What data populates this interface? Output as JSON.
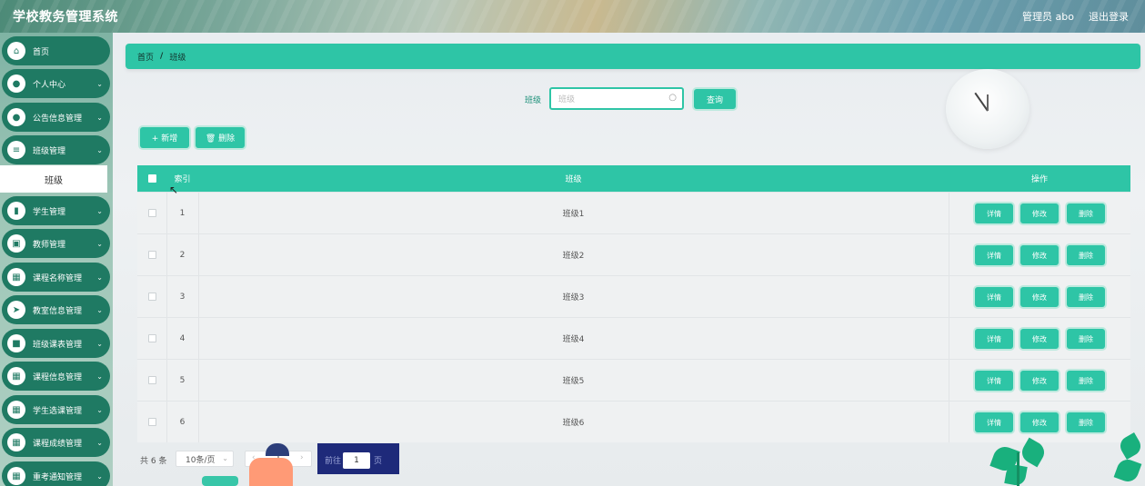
{
  "app": {
    "title": "学校教务管理系统"
  },
  "header": {
    "user": "管理员 abo",
    "logout": "退出登录"
  },
  "sidebar": {
    "items": [
      {
        "label": "首页",
        "icon": "home-icon",
        "glyph": "⌂",
        "chevron": false
      },
      {
        "label": "个人中心",
        "icon": "user-icon",
        "glyph": "●",
        "chevron": true
      },
      {
        "label": "公告信息管理",
        "icon": "user-icon",
        "glyph": "●",
        "chevron": true
      },
      {
        "label": "班级管理",
        "icon": "list-icon",
        "glyph": "≡",
        "chevron": true
      },
      {
        "label": "学生管理",
        "icon": "book-icon",
        "glyph": "▮",
        "chevron": true
      },
      {
        "label": "教师管理",
        "icon": "briefcase-icon",
        "glyph": "▣",
        "chevron": true
      },
      {
        "label": "课程名称管理",
        "icon": "grid-icon",
        "glyph": "▦",
        "chevron": true
      },
      {
        "label": "教室信息管理",
        "icon": "send-icon",
        "glyph": "➤",
        "chevron": true
      },
      {
        "label": "班级课表管理",
        "icon": "video-icon",
        "glyph": "■",
        "chevron": true
      },
      {
        "label": "课程信息管理",
        "icon": "grid-icon",
        "glyph": "▦",
        "chevron": true
      },
      {
        "label": "学生选课管理",
        "icon": "grid-icon",
        "glyph": "▦",
        "chevron": true
      },
      {
        "label": "课程成绩管理",
        "icon": "grid-icon",
        "glyph": "▦",
        "chevron": true
      },
      {
        "label": "重考通知管理",
        "icon": "grid-icon",
        "glyph": "▦",
        "chevron": true
      }
    ],
    "sub_item": "班级"
  },
  "breadcrumb": {
    "home": "首页",
    "separator": "/",
    "current": "班级"
  },
  "search": {
    "label": "班级",
    "placeholder": "班级",
    "button": "查询"
  },
  "actions": {
    "add": "+ 新增",
    "delete": "🗑 删除"
  },
  "table": {
    "headers": {
      "index": "索引",
      "class": "班级",
      "ops": "操作"
    },
    "rows": [
      {
        "index": "1",
        "class": "班级1"
      },
      {
        "index": "2",
        "class": "班级2"
      },
      {
        "index": "3",
        "class": "班级3"
      },
      {
        "index": "4",
        "class": "班级4"
      },
      {
        "index": "5",
        "class": "班级5"
      },
      {
        "index": "6",
        "class": "班级6"
      }
    ],
    "row_buttons": {
      "detail": "详情",
      "edit": "修改",
      "delete": "删除"
    }
  },
  "pagination": {
    "total": "共 6 条",
    "page_size": "10条/页",
    "prev": "‹",
    "current": "1",
    "next": "›",
    "goto_prefix": "前往",
    "goto_value": "1",
    "goto_suffix": "页"
  },
  "colors": {
    "accent": "#2ec5a6",
    "sidebar_item": "#1f7a63"
  }
}
